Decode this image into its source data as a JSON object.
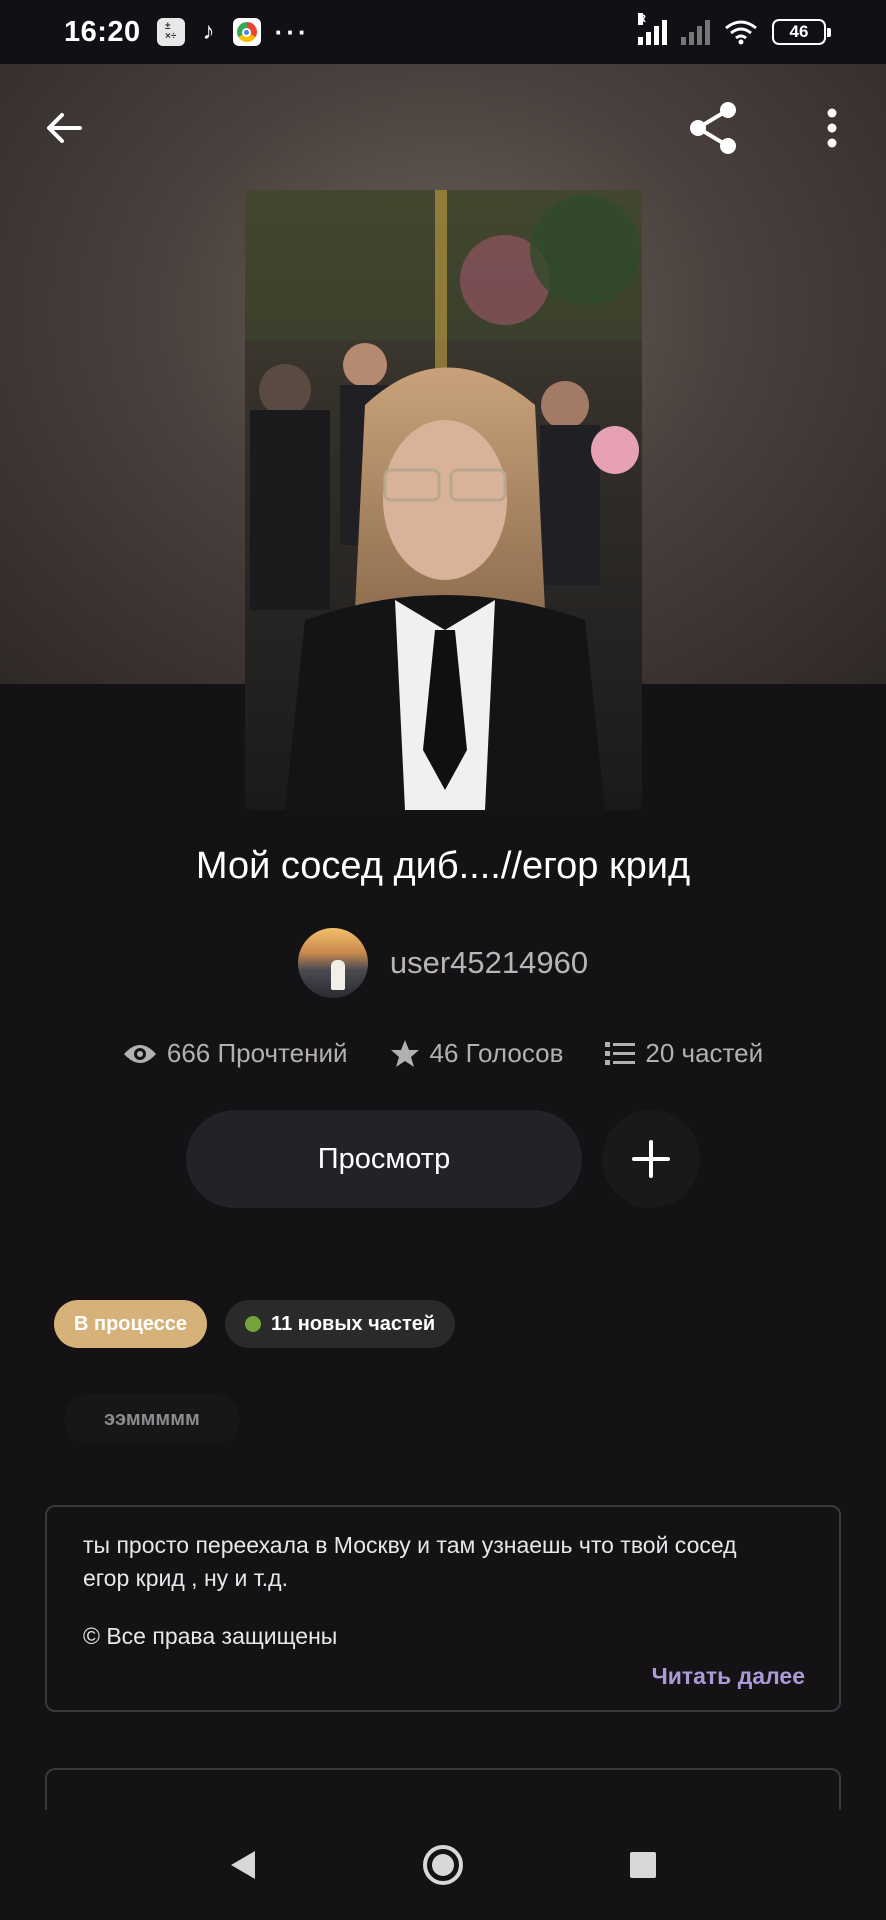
{
  "status_bar": {
    "time": "16:20",
    "apps": [
      "calculator-icon",
      "tiktok-icon",
      "chrome-icon"
    ],
    "overflow": "···",
    "battery": "46"
  },
  "header": {
    "back_icon": "arrow-left-icon",
    "share_icon": "share-icon",
    "more_icon": "more-vertical-icon"
  },
  "story": {
    "title": "Мой сосед диб....//егор крид",
    "author": "user45214960",
    "stats": {
      "reads": "666 Прочтений",
      "votes": "46 Голосов",
      "parts": "20 частей"
    },
    "read_button": "Просмотр",
    "status_badge": "В процессе",
    "new_parts_badge": "11 новых частей",
    "tag": "ээммммм",
    "description": "ты просто переехала в Москву и там узнаешь что твой сосед\nегор крид , ну и т.д.",
    "copyright": "© Все права защищены",
    "read_more": "Читать далее"
  },
  "colors": {
    "background": "#141215",
    "status_badge": "#d6b27a",
    "new_dot": "#74a33a",
    "read_more": "#a99bd8"
  }
}
